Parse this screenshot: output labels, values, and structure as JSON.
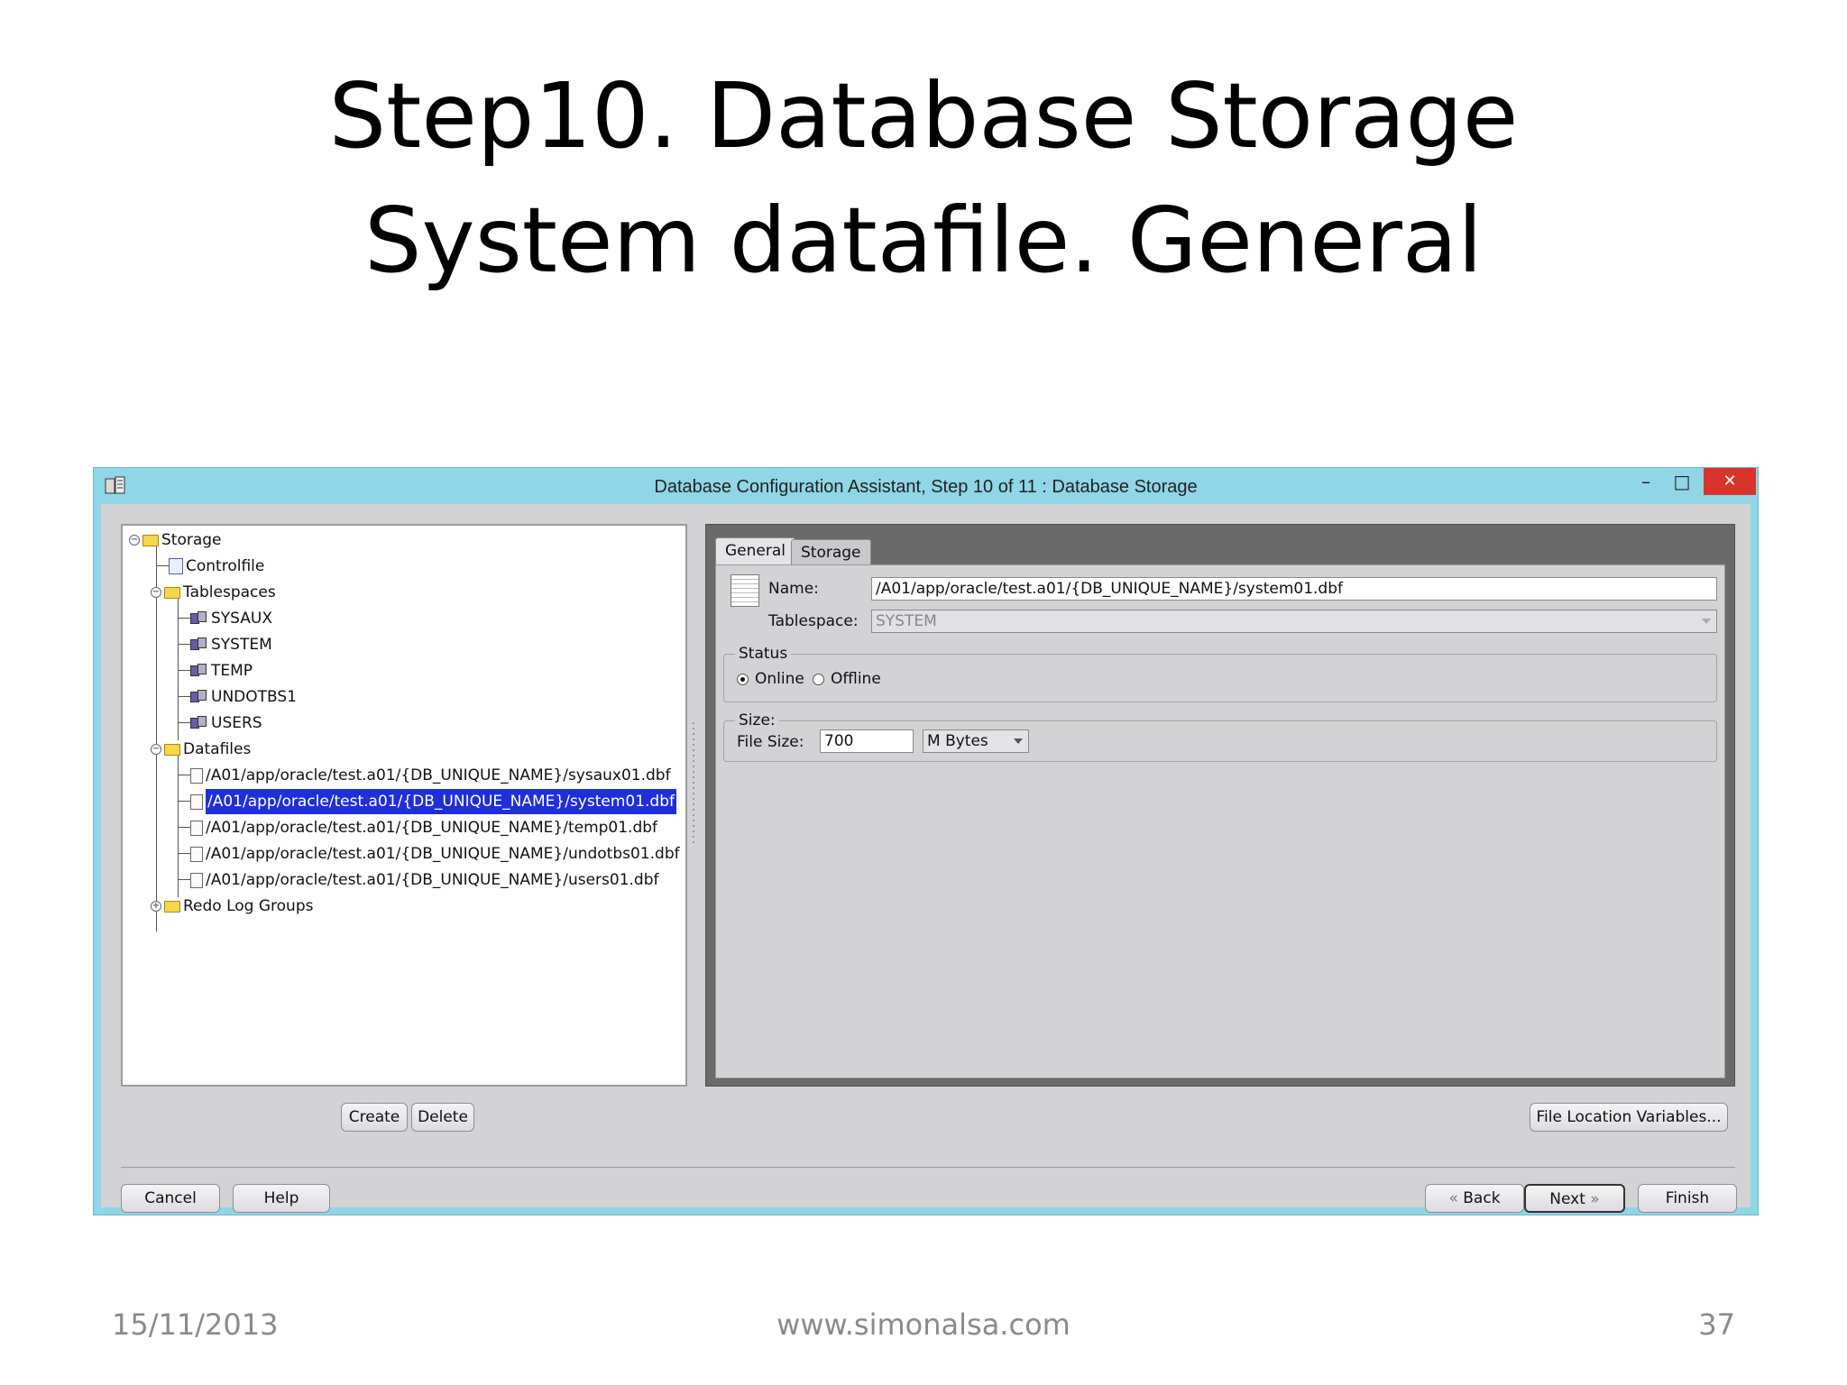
{
  "slide": {
    "title_line1": "Step10. Database Storage",
    "title_line2": "System datafile. General",
    "footer_date": "15/11/2013",
    "footer_site": "www.simonalsa.com",
    "footer_page": "37"
  },
  "window": {
    "title": "Database Configuration Assistant, Step 10 of 11 : Database Storage",
    "minimize": "–",
    "maximize": "□",
    "close": "✕"
  },
  "tree": {
    "storage": "Storage",
    "controlfile": "Controlfile",
    "tablespaces": "Tablespaces",
    "tablespace_items": [
      "SYSAUX",
      "SYSTEM",
      "TEMP",
      "UNDOTBS1",
      "USERS"
    ],
    "datafiles": "Datafiles",
    "datafile_items": [
      "/A01/app/oracle/test.a01/{DB_UNIQUE_NAME}/sysaux01.dbf",
      "/A01/app/oracle/test.a01/{DB_UNIQUE_NAME}/system01.dbf",
      "/A01/app/oracle/test.a01/{DB_UNIQUE_NAME}/temp01.dbf",
      "/A01/app/oracle/test.a01/{DB_UNIQUE_NAME}/undotbs01.dbf",
      "/A01/app/oracle/test.a01/{DB_UNIQUE_NAME}/users01.dbf"
    ],
    "redo": "Redo Log Groups"
  },
  "tabs": {
    "general": "General",
    "storage": "Storage"
  },
  "general": {
    "name_label": "Name:",
    "name_value": "/A01/app/oracle/test.a01/{DB_UNIQUE_NAME}/system01.dbf",
    "tablespace_label": "Tablespace:",
    "tablespace_value": "SYSTEM",
    "status_title": "Status",
    "online_label": "Online",
    "offline_label": "Offline",
    "size_title": "Size:",
    "file_size_label": "File Size:",
    "file_size_value": "700",
    "unit_value": "M Bytes"
  },
  "buttons": {
    "create": "Create",
    "delete": "Delete",
    "file_location": "File Location Variables...",
    "cancel": "Cancel",
    "help": "Help",
    "back": "Back",
    "next": "Next",
    "finish": "Finish"
  }
}
